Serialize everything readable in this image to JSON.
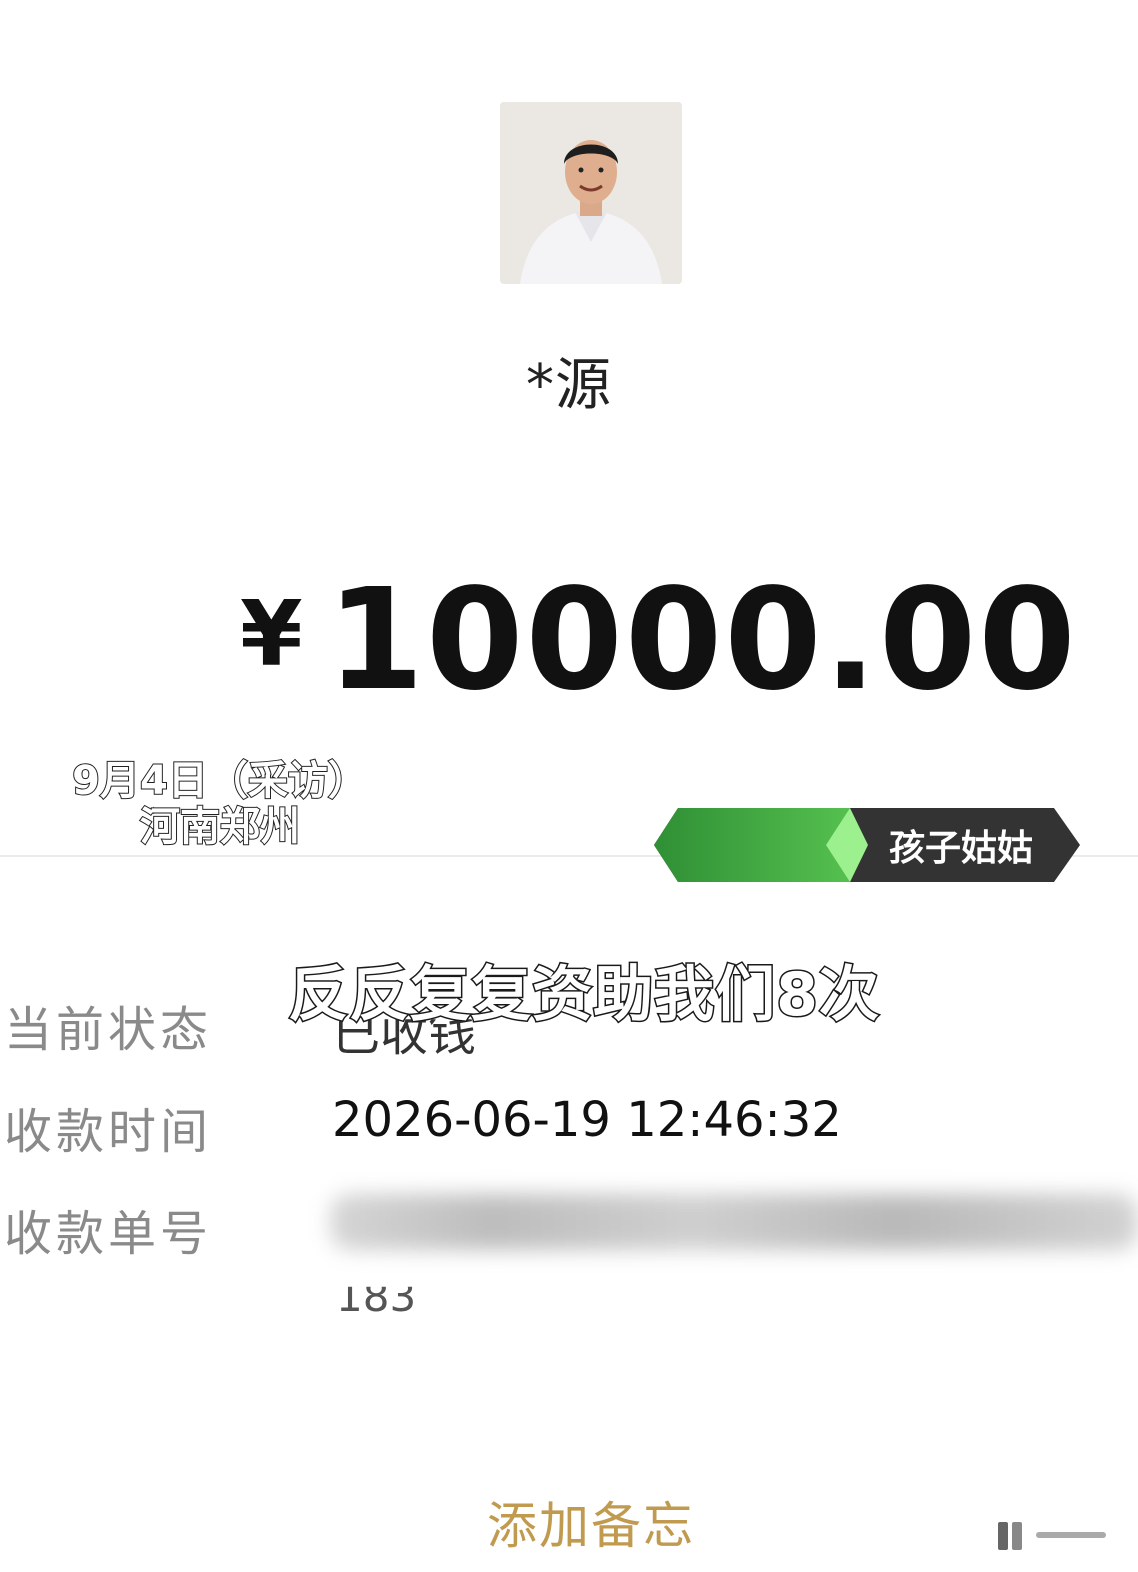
{
  "payee": {
    "name": "*源"
  },
  "payment": {
    "currency_symbol": "¥",
    "amount": "10000.00"
  },
  "overlays": {
    "date_caption": "9月4日（采访）",
    "location_caption": "河南郑州",
    "speaker_tag": "孩子姑姑",
    "subtitle": "反反复复资助我们8次"
  },
  "details": {
    "status_label": "当前状态",
    "status_value": "已收钱",
    "time_label": "收款时间",
    "time_value": "2026-06-19 12:46:32",
    "order_label": "收款单号",
    "order_tail": "183"
  },
  "actions": {
    "add_note_label": "添加备忘"
  },
  "colors": {
    "link_gold": "#c09a4f",
    "tag_green": "#3ea142",
    "tag_dark": "#333333"
  },
  "icons": {
    "avatar": "person-photo"
  }
}
